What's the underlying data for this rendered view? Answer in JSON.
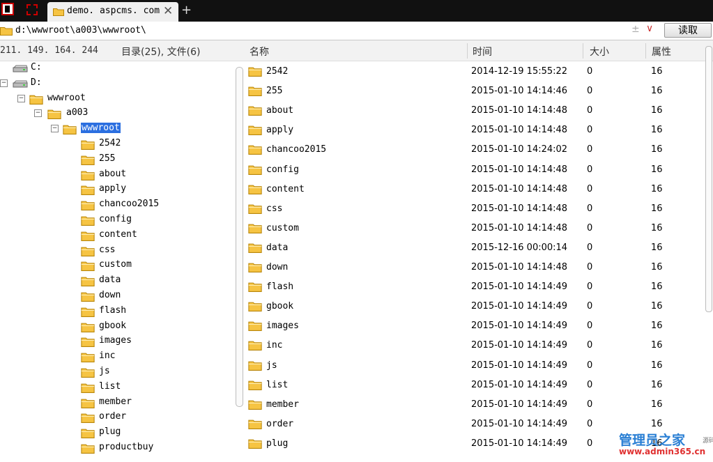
{
  "tab": {
    "title": "demo. aspcms. com",
    "close": "✕",
    "new_tab": "+"
  },
  "address": {
    "path": "d:\\wwwroot\\a003\\wwwroot\\",
    "plusminus": "±",
    "dropdown": "∨",
    "read_label": "读取"
  },
  "header": {
    "ip": "211. 149. 164. 244",
    "count": "目录(25), 文件(6)",
    "name": "名称",
    "time": "时间",
    "size": "大小",
    "attr": "属性"
  },
  "tree": {
    "drives": [
      "C:",
      "D:"
    ],
    "wwwroot": "wwwroot",
    "a003": "a003",
    "selected": "wwwroot",
    "folders": [
      "2542",
      "255",
      "about",
      "apply",
      "chancoo2015",
      "config",
      "content",
      "css",
      "custom",
      "data",
      "down",
      "flash",
      "gbook",
      "images",
      "inc",
      "js",
      "list",
      "member",
      "order",
      "plug",
      "productbuy"
    ],
    "expand_minus": "−"
  },
  "files": [
    {
      "name": "2542",
      "time": "2014-12-19 15:55:22",
      "size": "0",
      "attr": "16"
    },
    {
      "name": "255",
      "time": "2015-01-10 14:14:46",
      "size": "0",
      "attr": "16"
    },
    {
      "name": "about",
      "time": "2015-01-10 14:14:48",
      "size": "0",
      "attr": "16"
    },
    {
      "name": "apply",
      "time": "2015-01-10 14:14:48",
      "size": "0",
      "attr": "16"
    },
    {
      "name": "chancoo2015",
      "time": "2015-01-10 14:24:02",
      "size": "0",
      "attr": "16"
    },
    {
      "name": "config",
      "time": "2015-01-10 14:14:48",
      "size": "0",
      "attr": "16"
    },
    {
      "name": "content",
      "time": "2015-01-10 14:14:48",
      "size": "0",
      "attr": "16"
    },
    {
      "name": "css",
      "time": "2015-01-10 14:14:48",
      "size": "0",
      "attr": "16"
    },
    {
      "name": "custom",
      "time": "2015-01-10 14:14:48",
      "size": "0",
      "attr": "16"
    },
    {
      "name": "data",
      "time": "2015-12-16 00:00:14",
      "size": "0",
      "attr": "16"
    },
    {
      "name": "down",
      "time": "2015-01-10 14:14:48",
      "size": "0",
      "attr": "16"
    },
    {
      "name": "flash",
      "time": "2015-01-10 14:14:49",
      "size": "0",
      "attr": "16"
    },
    {
      "name": "gbook",
      "time": "2015-01-10 14:14:49",
      "size": "0",
      "attr": "16"
    },
    {
      "name": "images",
      "time": "2015-01-10 14:14:49",
      "size": "0",
      "attr": "16"
    },
    {
      "name": "inc",
      "time": "2015-01-10 14:14:49",
      "size": "0",
      "attr": "16"
    },
    {
      "name": "js",
      "time": "2015-01-10 14:14:49",
      "size": "0",
      "attr": "16"
    },
    {
      "name": "list",
      "time": "2015-01-10 14:14:49",
      "size": "0",
      "attr": "16"
    },
    {
      "name": "member",
      "time": "2015-01-10 14:14:49",
      "size": "0",
      "attr": "16"
    },
    {
      "name": "order",
      "time": "2015-01-10 14:14:49",
      "size": "0",
      "attr": "16"
    },
    {
      "name": "plug",
      "time": "2015-01-10 14:14:49",
      "size": "0",
      "attr": "16"
    }
  ],
  "watermark": {
    "title": "管理员之家",
    "url": "www.admin365.cn",
    "small": "源码"
  },
  "colors": {
    "folder": "#f6c443",
    "folder_edge": "#b8860b",
    "selected": "#2b6fe0"
  },
  "icons": {
    "folder": "folder-icon",
    "drive": "drive-icon"
  }
}
